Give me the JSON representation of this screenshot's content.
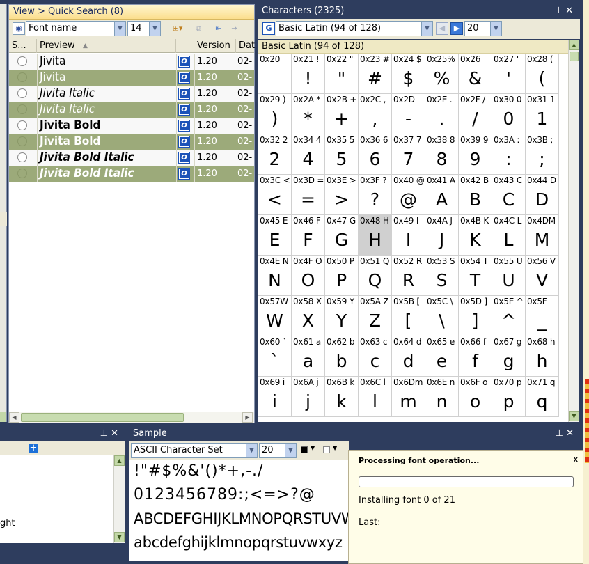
{
  "quick_search": {
    "title": "View > Quick Search (8)",
    "font_name_label": "Font name",
    "size_value": "14",
    "columns": [
      "S...",
      "Preview",
      "Version",
      "Dat"
    ],
    "rows": [
      {
        "name": "Jivita",
        "version": "1.20",
        "date": "02-",
        "selected": false,
        "style": "normal"
      },
      {
        "name": "Jivita",
        "version": "1.20",
        "date": "02-",
        "selected": true,
        "style": "normal"
      },
      {
        "name": "Jivita Italic",
        "version": "1.20",
        "date": "02-",
        "selected": false,
        "style": "italic"
      },
      {
        "name": "Jivita Italic",
        "version": "1.20",
        "date": "02-",
        "selected": true,
        "style": "italic"
      },
      {
        "name": "Jivita Bold",
        "version": "1.20",
        "date": "02-",
        "selected": false,
        "style": "bold"
      },
      {
        "name": "Jivita Bold",
        "version": "1.20",
        "date": "02-",
        "selected": true,
        "style": "bold"
      },
      {
        "name": "Jivita Bold Italic",
        "version": "1.20",
        "date": "02-",
        "selected": false,
        "style": "bolditalic"
      },
      {
        "name": "Jivita Bold Italic",
        "version": "1.20",
        "date": "02-",
        "selected": true,
        "style": "bolditalic"
      }
    ],
    "opentype_icon_label": "O"
  },
  "characters": {
    "title": "Characters (2325)",
    "charset_value": "Basic Latin (94 of 128)",
    "count_value": "20",
    "group_header": "Basic Latin (94 of 128)",
    "cells": [
      {
        "code": "0x20",
        "glyph": ""
      },
      {
        "code": "0x21 !",
        "glyph": "!"
      },
      {
        "code": "0x22 \"",
        "glyph": "\""
      },
      {
        "code": "0x23 #",
        "glyph": "#"
      },
      {
        "code": "0x24 $",
        "glyph": "$"
      },
      {
        "code": "0x25%",
        "glyph": "%"
      },
      {
        "code": "0x26",
        "glyph": "&"
      },
      {
        "code": "0x27 '",
        "glyph": "'"
      },
      {
        "code": "0x28 (",
        "glyph": "("
      },
      {
        "code": "0x29 )",
        "glyph": ")"
      },
      {
        "code": "0x2A *",
        "glyph": "*"
      },
      {
        "code": "0x2B +",
        "glyph": "+"
      },
      {
        "code": "0x2C ,",
        "glyph": ","
      },
      {
        "code": "0x2D -",
        "glyph": "-"
      },
      {
        "code": "0x2E .",
        "glyph": "."
      },
      {
        "code": "0x2F /",
        "glyph": "/"
      },
      {
        "code": "0x30 0",
        "glyph": "0"
      },
      {
        "code": "0x31 1",
        "glyph": "1"
      },
      {
        "code": "0x32 2",
        "glyph": "2"
      },
      {
        "code": "0x34 4",
        "glyph": "4"
      },
      {
        "code": "0x35 5",
        "glyph": "5"
      },
      {
        "code": "0x36 6",
        "glyph": "6"
      },
      {
        "code": "0x37 7",
        "glyph": "7"
      },
      {
        "code": "0x38 8",
        "glyph": "8"
      },
      {
        "code": "0x39 9",
        "glyph": "9"
      },
      {
        "code": "0x3A :",
        "glyph": ":"
      },
      {
        "code": "0x3B ;",
        "glyph": ";"
      },
      {
        "code": "0x3C <",
        "glyph": "<"
      },
      {
        "code": "0x3D =",
        "glyph": "="
      },
      {
        "code": "0x3E >",
        "glyph": ">"
      },
      {
        "code": "0x3F ?",
        "glyph": "?"
      },
      {
        "code": "0x40 @",
        "glyph": "@"
      },
      {
        "code": "0x41 A",
        "glyph": "A"
      },
      {
        "code": "0x42 B",
        "glyph": "B"
      },
      {
        "code": "0x43 C",
        "glyph": "C"
      },
      {
        "code": "0x44 D",
        "glyph": "D"
      },
      {
        "code": "0x45 E",
        "glyph": "E"
      },
      {
        "code": "0x46 F",
        "glyph": "F"
      },
      {
        "code": "0x47 G",
        "glyph": "G"
      },
      {
        "code": "0x48 H",
        "glyph": "H",
        "highlight": true
      },
      {
        "code": "0x49 I",
        "glyph": "I"
      },
      {
        "code": "0x4A J",
        "glyph": "J"
      },
      {
        "code": "0x4B K",
        "glyph": "K"
      },
      {
        "code": "0x4C L",
        "glyph": "L"
      },
      {
        "code": "0x4DM",
        "glyph": "M"
      },
      {
        "code": "0x4E N",
        "glyph": "N"
      },
      {
        "code": "0x4F O",
        "glyph": "O"
      },
      {
        "code": "0x50 P",
        "glyph": "P"
      },
      {
        "code": "0x51 Q",
        "glyph": "Q"
      },
      {
        "code": "0x52 R",
        "glyph": "R"
      },
      {
        "code": "0x53 S",
        "glyph": "S"
      },
      {
        "code": "0x54 T",
        "glyph": "T"
      },
      {
        "code": "0x55 U",
        "glyph": "U"
      },
      {
        "code": "0x56 V",
        "glyph": "V"
      },
      {
        "code": "0x57W",
        "glyph": "W"
      },
      {
        "code": "0x58 X",
        "glyph": "X"
      },
      {
        "code": "0x59 Y",
        "glyph": "Y"
      },
      {
        "code": "0x5A Z",
        "glyph": "Z"
      },
      {
        "code": "0x5B [",
        "glyph": "["
      },
      {
        "code": "0x5C \\",
        "glyph": "\\"
      },
      {
        "code": "0x5D ]",
        "glyph": "]"
      },
      {
        "code": "0x5E ^",
        "glyph": "^"
      },
      {
        "code": "0x5F _",
        "glyph": "_"
      },
      {
        "code": "0x60 `",
        "glyph": "`"
      },
      {
        "code": "0x61 a",
        "glyph": "a"
      },
      {
        "code": "0x62 b",
        "glyph": "b"
      },
      {
        "code": "0x63 c",
        "glyph": "c"
      },
      {
        "code": "0x64 d",
        "glyph": "d"
      },
      {
        "code": "0x65 e",
        "glyph": "e"
      },
      {
        "code": "0x66 f",
        "glyph": "f"
      },
      {
        "code": "0x67 g",
        "glyph": "g"
      },
      {
        "code": "0x68 h",
        "glyph": "h"
      },
      {
        "code": "0x69 i",
        "glyph": "i"
      },
      {
        "code": "0x6A j",
        "glyph": "j"
      },
      {
        "code": "0x6B k",
        "glyph": "k"
      },
      {
        "code": "0x6C l",
        "glyph": "l"
      },
      {
        "code": "0x6Dm",
        "glyph": "m"
      },
      {
        "code": "0x6E n",
        "glyph": "n"
      },
      {
        "code": "0x6F o",
        "glyph": "o"
      },
      {
        "code": "0x70 p",
        "glyph": "p"
      },
      {
        "code": "0x71 q",
        "glyph": "q"
      }
    ]
  },
  "sample": {
    "title": "Sample",
    "charset_value": "ASCII Character Set",
    "size_value": "20",
    "lines": [
      "!\"#$%&'()*+,-./",
      "0123456789:;<=>?@",
      "ABCDEFGHIJKLMNOPQRSTUVWXYZ",
      "abcdefghijklmnopqrstuvwxyz"
    ]
  },
  "left_panel": {
    "partial_text": "ght"
  },
  "progress": {
    "title": "Processing font operation...",
    "close_label": "x",
    "status": "Installing font 0 of 21",
    "last_label": "Last:",
    "progress_fraction": 0
  },
  "colors": {
    "accent_selected_row": "#9caa7a",
    "panel_title_bg": "#2e3d5e",
    "highlight_cell": "#d0d0d0",
    "quick_search_title_bg": "#fde9a6"
  }
}
